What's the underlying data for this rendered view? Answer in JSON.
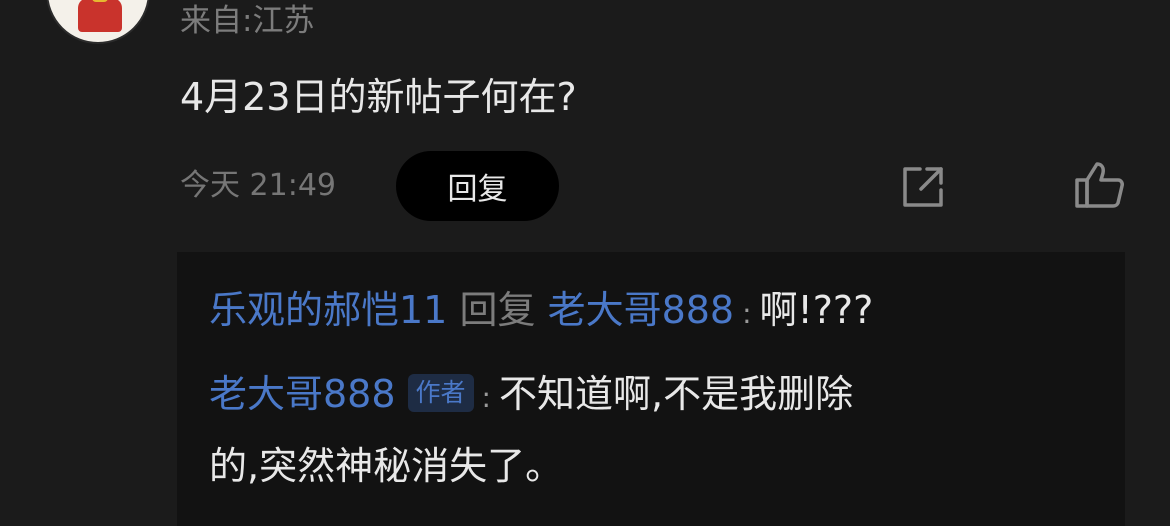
{
  "comment": {
    "location": "来自:江苏",
    "text": "4月23日的新帖子何在?",
    "time": "今天 21:49",
    "reply_label": "回复"
  },
  "icons": {
    "share": "share-icon",
    "like": "thumbs-up-icon"
  },
  "replies": [
    {
      "from": "乐观的郝恺11",
      "reply_word": "回复",
      "to": "老大哥888",
      "sep": ":",
      "text": "啊!???"
    },
    {
      "from": "老大哥888",
      "tag": "作者",
      "sep": ":",
      "text_line1": "不知道啊,不是我删除",
      "text_line2": "的,突然神秘消失了。"
    }
  ],
  "colors": {
    "background": "#1b1b1b",
    "reply_panel": "#121212",
    "link_blue": "#4a78c8",
    "muted": "#7c7c7c"
  }
}
